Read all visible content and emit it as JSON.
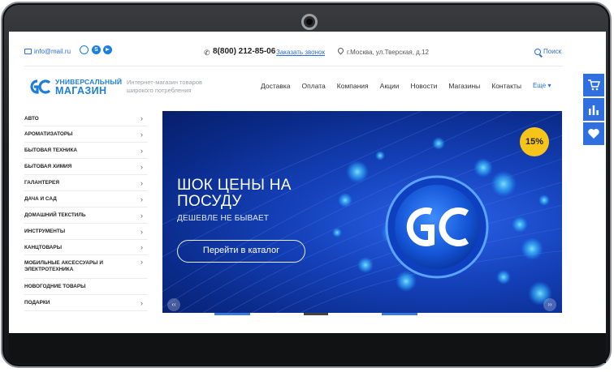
{
  "topbar": {
    "email": "info@mail.ru",
    "phone": "8(800) 212-85-06",
    "callback": "Заказать звонок",
    "address": "г.Москва, ул.Тверская, д.12",
    "search": "Поиск"
  },
  "header": {
    "logo_line1": "УНИВЕРСАЛЬНЫЙ",
    "logo_line2": "МАГАЗИН",
    "tagline": "Интернет-магазин товаров широкого потребления",
    "nav": [
      "Доставка",
      "Оплата",
      "Компания",
      "Акции",
      "Новости",
      "Магазины",
      "Контакты"
    ],
    "nav_more": "Еще ▾"
  },
  "sidebar": {
    "categories": [
      {
        "label": "АВТО",
        "arrow": "›"
      },
      {
        "label": "АРОМАТИЗАТОРЫ",
        "arrow": "›"
      },
      {
        "label": "БЫТОВАЯ ТЕХНИКА",
        "arrow": "›"
      },
      {
        "label": "БЫТОВАЯ ХИМИЯ",
        "arrow": "›"
      },
      {
        "label": "ГАЛАНТЕРЕЯ",
        "arrow": "›"
      },
      {
        "label": "ДАЧА И САД",
        "arrow": "›"
      },
      {
        "label": "ДОМАШНИЙ ТЕКСТИЛЬ",
        "arrow": "›"
      },
      {
        "label": "ИНСТРУМЕНТЫ",
        "arrow": "›"
      },
      {
        "label": "КАНЦТОВАРЫ",
        "arrow": "›"
      },
      {
        "label": "МОБИЛЬНЫЕ АКСЕССУАРЫ И ЭЛЕКТРОТЕХНИКА",
        "arrow": "›"
      },
      {
        "label": "НОВОГОДНИЕ ТОВАРЫ",
        "arrow": ""
      },
      {
        "label": "ПОДАРКИ",
        "arrow": "›"
      }
    ]
  },
  "banner": {
    "title_line1": "ШОК ЦЕНЫ НА",
    "title_line2": "ПОСУДУ",
    "subtitle": "ДЕШЕВЛЕ НЕ БЫВАЕТ",
    "button": "Перейти в каталог",
    "badge": "15%",
    "prev": "‹‹",
    "next": "››"
  },
  "widgets": {
    "icons": [
      "cart-icon",
      "chart-icon",
      "heart-icon"
    ],
    "accent": "#2f6fe0"
  },
  "colors": {
    "brand": "#1d7ed8",
    "link": "#2a6fd6",
    "badge": "#f7c41a"
  }
}
